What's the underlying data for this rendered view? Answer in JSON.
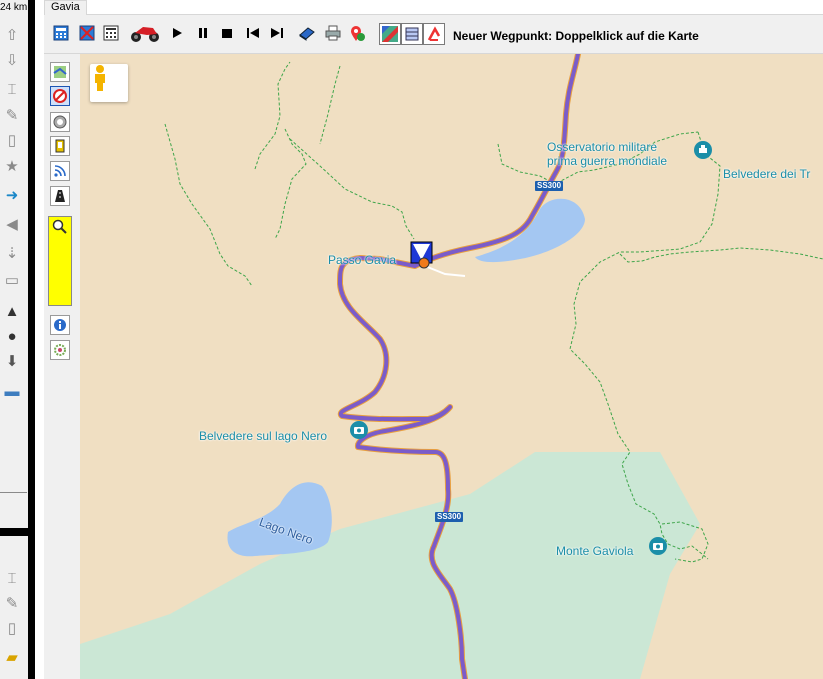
{
  "left_panel": {
    "distance": "24 km",
    "icons": [
      "arrow-up-icon",
      "arrow-down-icon",
      "insert-cursor-icon",
      "pencil-icon",
      "trash-icon",
      "star-icon",
      "route-arrow-icon",
      "speaker-icon",
      "split-arrow-icon",
      "bed-icon",
      "road-icon",
      "turtle-icon",
      "stamp-icon",
      "landscape-icon",
      "insert-cursor-icon",
      "pencil-icon",
      "trash-icon",
      "folder-icon"
    ]
  },
  "tab": {
    "label": "Gavia"
  },
  "toolbar": {
    "hint": "Neuer Wegpunkt: Doppelklick auf die Karte",
    "buttons": [
      "calculator-icon",
      "cancel-calculation-icon",
      "table-icon",
      "motorcycle-icon",
      "play-icon",
      "pause-icon",
      "stop-icon",
      "skip-back-icon",
      "skip-forward-icon",
      "book-icon",
      "printer-icon",
      "waypoint-pin-icon",
      "google-maps-icon",
      "openstreetmap-icon",
      "strava-icon"
    ]
  },
  "sidebar": {
    "buttons": [
      "map-layer-icon",
      "no-traffic-icon",
      "circle-target-icon",
      "phone-car-icon",
      "rss-icon",
      "road-warning-icon",
      "magnifier-icon",
      "info-icon",
      "settings-icon"
    ]
  },
  "map": {
    "colors": {
      "land": "#f0dfc2",
      "forest": "#cbe7d5",
      "water": "#a4c7f2",
      "route": "#7b5cc9",
      "trail": "#3ea54a"
    },
    "labels": {
      "passo_gavia": "Passo Gavia",
      "observatorio_line1": "Osservatorio militare",
      "observatorio_line2": "prima guerra mondiale",
      "belvedere_dei_tre": "Belvedere dei Tr",
      "belvedere_lago_nero": "Belvedere sul lago Nero",
      "lago_nero": "Lago Nero",
      "monte_gaviola": "Monte Gaviola",
      "road_shield_1": "SS300",
      "road_shield_2": "SS300"
    }
  }
}
